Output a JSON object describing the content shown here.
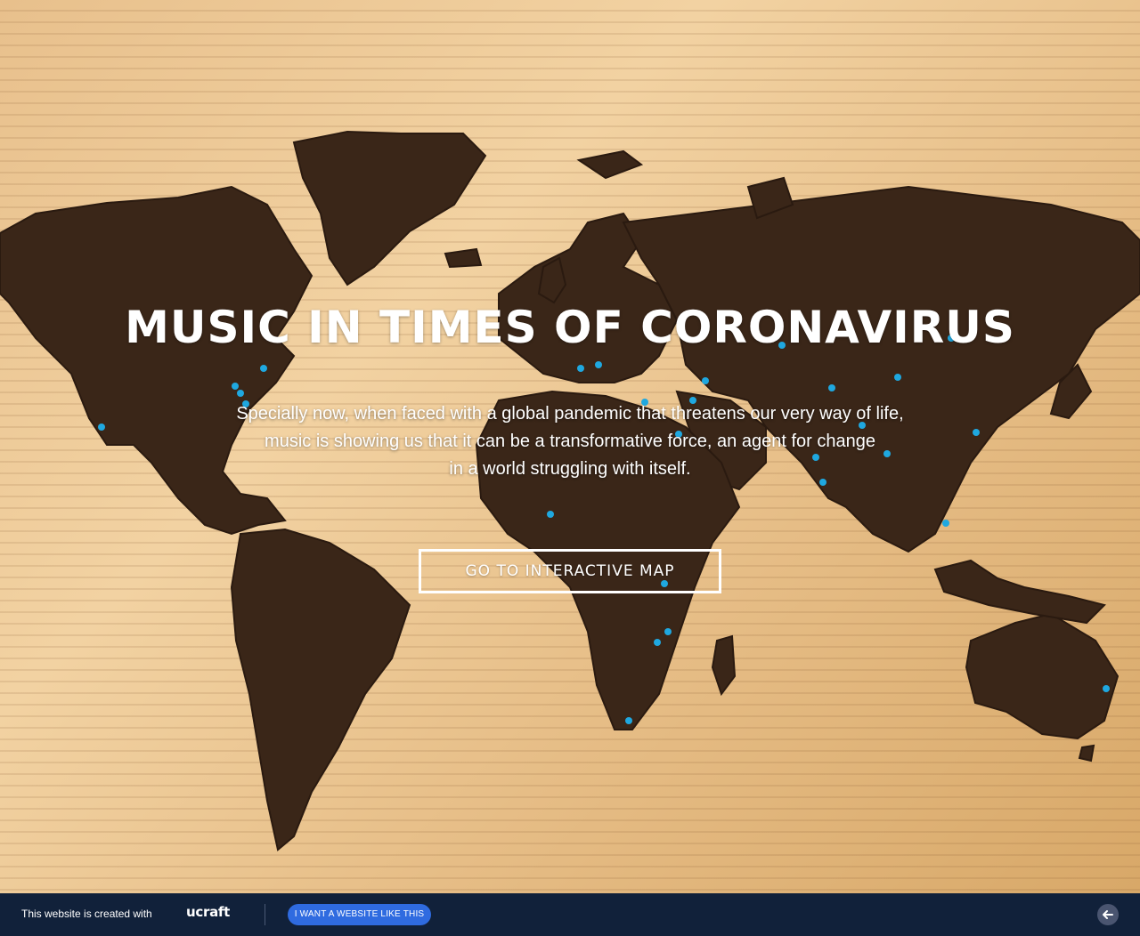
{
  "hero": {
    "title": "MUSIC IN TIMES OF CORONAVIRUS",
    "description_lines": [
      "Specially now, when faced with a global pandemic that threatens our very way of life,",
      "music is showing us that it can be a transformative force, an agent for change",
      "in a world struggling with itself."
    ],
    "cta_label": "GO TO INTERACTIVE MAP"
  },
  "footer": {
    "created_with": "This website is created with",
    "logo": "ucraft",
    "button_label": "I WANT A WEBSITE LIKE THIS",
    "back_icon": "arrow-left-icon"
  },
  "colors": {
    "footer_background": "#11213a",
    "footer_button": "#2f6be0",
    "map_land": "#3a2618",
    "map_pin": "#1fa8e0"
  }
}
